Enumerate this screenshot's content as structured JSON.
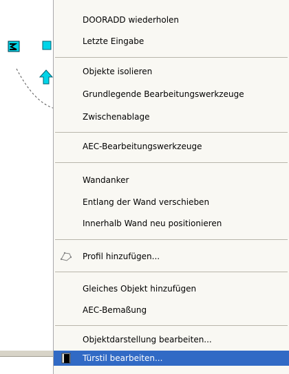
{
  "context_menu": {
    "items": [
      {
        "label": "DOORADD wiederholen",
        "icon": null,
        "state": "normal"
      },
      {
        "label": "Letzte Eingabe",
        "icon": null,
        "state": "normal"
      },
      {
        "label": "Objekte isolieren",
        "icon": null,
        "state": "normal"
      },
      {
        "label": "Grundlegende Bearbeitungswerkzeuge",
        "icon": null,
        "state": "normal"
      },
      {
        "label": "Zwischenablage",
        "icon": null,
        "state": "normal"
      },
      {
        "label": "AEC-Bearbeitungswerkzeuge",
        "icon": null,
        "state": "normal"
      },
      {
        "label": "Wandanker",
        "icon": null,
        "state": "normal"
      },
      {
        "label": "Entlang der Wand verschieben",
        "icon": null,
        "state": "normal"
      },
      {
        "label": "Innerhalb Wand neu positionieren",
        "icon": null,
        "state": "normal"
      },
      {
        "label": "Profil hinzufügen...",
        "icon": "profile-polygon-icon",
        "state": "normal"
      },
      {
        "label": "Gleiches Objekt hinzufügen",
        "icon": null,
        "state": "normal"
      },
      {
        "label": "AEC-Bemaßung",
        "icon": null,
        "state": "normal"
      },
      {
        "label": "Objektdarstellung bearbeiten...",
        "icon": null,
        "state": "normal"
      },
      {
        "label": "Türstil bearbeiten...",
        "icon": "door-style-icon",
        "state": "highlighted"
      }
    ]
  },
  "canvas": {
    "grip_icons": [
      "flip-grip-icon",
      "square-grip-icon",
      "arrow-up-grip-icon"
    ],
    "grip_color": "#00c8e0"
  },
  "colors": {
    "menu_background": "#f9f8f3",
    "highlight_background": "#316ac5",
    "highlight_text": "#ffffff",
    "separator": "#b8b5aa"
  }
}
